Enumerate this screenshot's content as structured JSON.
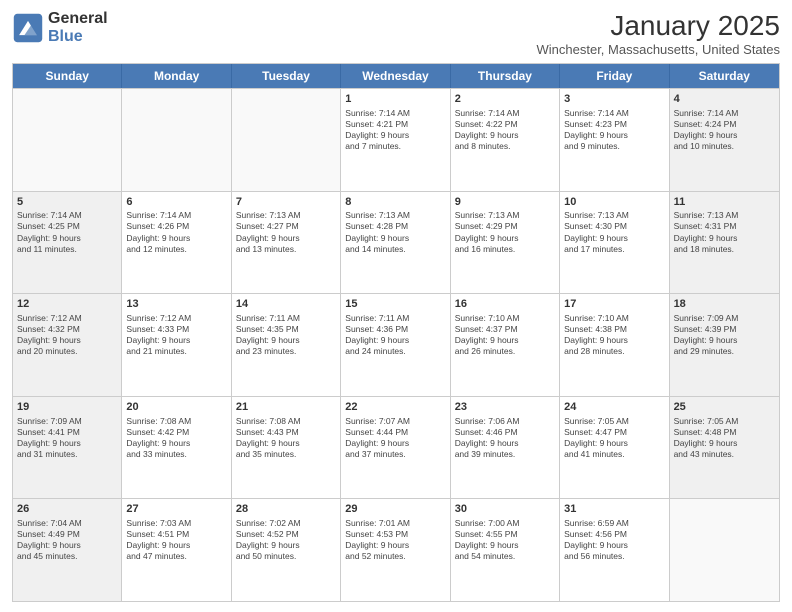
{
  "logo": {
    "general": "General",
    "blue": "Blue"
  },
  "header": {
    "month_year": "January 2025",
    "location": "Winchester, Massachusetts, United States"
  },
  "days_of_week": [
    "Sunday",
    "Monday",
    "Tuesday",
    "Wednesday",
    "Thursday",
    "Friday",
    "Saturday"
  ],
  "weeks": [
    [
      {
        "day": "",
        "info": "",
        "empty": true
      },
      {
        "day": "",
        "info": "",
        "empty": true
      },
      {
        "day": "",
        "info": "",
        "empty": true
      },
      {
        "day": "1",
        "info": "Sunrise: 7:14 AM\nSunset: 4:21 PM\nDaylight: 9 hours\nand 7 minutes.",
        "empty": false
      },
      {
        "day": "2",
        "info": "Sunrise: 7:14 AM\nSunset: 4:22 PM\nDaylight: 9 hours\nand 8 minutes.",
        "empty": false
      },
      {
        "day": "3",
        "info": "Sunrise: 7:14 AM\nSunset: 4:23 PM\nDaylight: 9 hours\nand 9 minutes.",
        "empty": false
      },
      {
        "day": "4",
        "info": "Sunrise: 7:14 AM\nSunset: 4:24 PM\nDaylight: 9 hours\nand 10 minutes.",
        "empty": false
      }
    ],
    [
      {
        "day": "5",
        "info": "Sunrise: 7:14 AM\nSunset: 4:25 PM\nDaylight: 9 hours\nand 11 minutes.",
        "empty": false
      },
      {
        "day": "6",
        "info": "Sunrise: 7:14 AM\nSunset: 4:26 PM\nDaylight: 9 hours\nand 12 minutes.",
        "empty": false
      },
      {
        "day": "7",
        "info": "Sunrise: 7:13 AM\nSunset: 4:27 PM\nDaylight: 9 hours\nand 13 minutes.",
        "empty": false
      },
      {
        "day": "8",
        "info": "Sunrise: 7:13 AM\nSunset: 4:28 PM\nDaylight: 9 hours\nand 14 minutes.",
        "empty": false
      },
      {
        "day": "9",
        "info": "Sunrise: 7:13 AM\nSunset: 4:29 PM\nDaylight: 9 hours\nand 16 minutes.",
        "empty": false
      },
      {
        "day": "10",
        "info": "Sunrise: 7:13 AM\nSunset: 4:30 PM\nDaylight: 9 hours\nand 17 minutes.",
        "empty": false
      },
      {
        "day": "11",
        "info": "Sunrise: 7:13 AM\nSunset: 4:31 PM\nDaylight: 9 hours\nand 18 minutes.",
        "empty": false
      }
    ],
    [
      {
        "day": "12",
        "info": "Sunrise: 7:12 AM\nSunset: 4:32 PM\nDaylight: 9 hours\nand 20 minutes.",
        "empty": false
      },
      {
        "day": "13",
        "info": "Sunrise: 7:12 AM\nSunset: 4:33 PM\nDaylight: 9 hours\nand 21 minutes.",
        "empty": false
      },
      {
        "day": "14",
        "info": "Sunrise: 7:11 AM\nSunset: 4:35 PM\nDaylight: 9 hours\nand 23 minutes.",
        "empty": false
      },
      {
        "day": "15",
        "info": "Sunrise: 7:11 AM\nSunset: 4:36 PM\nDaylight: 9 hours\nand 24 minutes.",
        "empty": false
      },
      {
        "day": "16",
        "info": "Sunrise: 7:10 AM\nSunset: 4:37 PM\nDaylight: 9 hours\nand 26 minutes.",
        "empty": false
      },
      {
        "day": "17",
        "info": "Sunrise: 7:10 AM\nSunset: 4:38 PM\nDaylight: 9 hours\nand 28 minutes.",
        "empty": false
      },
      {
        "day": "18",
        "info": "Sunrise: 7:09 AM\nSunset: 4:39 PM\nDaylight: 9 hours\nand 29 minutes.",
        "empty": false
      }
    ],
    [
      {
        "day": "19",
        "info": "Sunrise: 7:09 AM\nSunset: 4:41 PM\nDaylight: 9 hours\nand 31 minutes.",
        "empty": false
      },
      {
        "day": "20",
        "info": "Sunrise: 7:08 AM\nSunset: 4:42 PM\nDaylight: 9 hours\nand 33 minutes.",
        "empty": false
      },
      {
        "day": "21",
        "info": "Sunrise: 7:08 AM\nSunset: 4:43 PM\nDaylight: 9 hours\nand 35 minutes.",
        "empty": false
      },
      {
        "day": "22",
        "info": "Sunrise: 7:07 AM\nSunset: 4:44 PM\nDaylight: 9 hours\nand 37 minutes.",
        "empty": false
      },
      {
        "day": "23",
        "info": "Sunrise: 7:06 AM\nSunset: 4:46 PM\nDaylight: 9 hours\nand 39 minutes.",
        "empty": false
      },
      {
        "day": "24",
        "info": "Sunrise: 7:05 AM\nSunset: 4:47 PM\nDaylight: 9 hours\nand 41 minutes.",
        "empty": false
      },
      {
        "day": "25",
        "info": "Sunrise: 7:05 AM\nSunset: 4:48 PM\nDaylight: 9 hours\nand 43 minutes.",
        "empty": false
      }
    ],
    [
      {
        "day": "26",
        "info": "Sunrise: 7:04 AM\nSunset: 4:49 PM\nDaylight: 9 hours\nand 45 minutes.",
        "empty": false
      },
      {
        "day": "27",
        "info": "Sunrise: 7:03 AM\nSunset: 4:51 PM\nDaylight: 9 hours\nand 47 minutes.",
        "empty": false
      },
      {
        "day": "28",
        "info": "Sunrise: 7:02 AM\nSunset: 4:52 PM\nDaylight: 9 hours\nand 50 minutes.",
        "empty": false
      },
      {
        "day": "29",
        "info": "Sunrise: 7:01 AM\nSunset: 4:53 PM\nDaylight: 9 hours\nand 52 minutes.",
        "empty": false
      },
      {
        "day": "30",
        "info": "Sunrise: 7:00 AM\nSunset: 4:55 PM\nDaylight: 9 hours\nand 54 minutes.",
        "empty": false
      },
      {
        "day": "31",
        "info": "Sunrise: 6:59 AM\nSunset: 4:56 PM\nDaylight: 9 hours\nand 56 minutes.",
        "empty": false
      },
      {
        "day": "",
        "info": "",
        "empty": true
      }
    ]
  ]
}
